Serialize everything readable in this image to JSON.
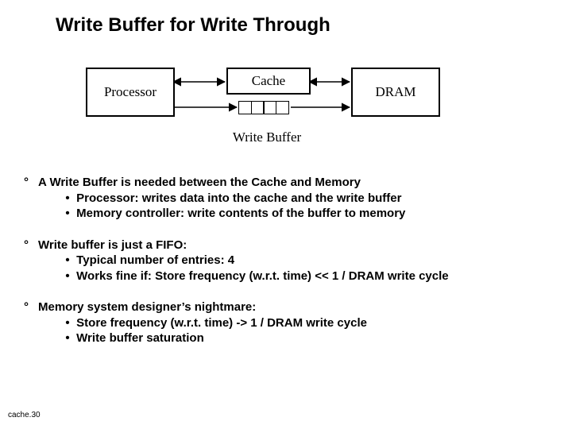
{
  "title": "Write Buffer for Write Through",
  "diagram": {
    "processor": "Processor",
    "cache": "Cache",
    "dram": "DRAM",
    "wb_label": "Write Buffer"
  },
  "bullets": {
    "b1": {
      "head": "A Write Buffer is needed between the Cache and Memory",
      "sub1": "Processor: writes data into the cache and the write buffer",
      "sub2": "Memory controller: write contents of the buffer to memory"
    },
    "b2": {
      "head": "Write buffer is just a FIFO:",
      "sub1": "Typical number of entries: 4",
      "sub2": "Works fine if:  Store frequency (w.r.t. time) << 1 / DRAM write cycle"
    },
    "b3": {
      "head": "Memory system designer’s nightmare:",
      "sub1": "Store frequency (w.r.t. time)   ->  1 / DRAM write cycle",
      "sub2": "Write buffer saturation"
    }
  },
  "footer": "cache.30"
}
